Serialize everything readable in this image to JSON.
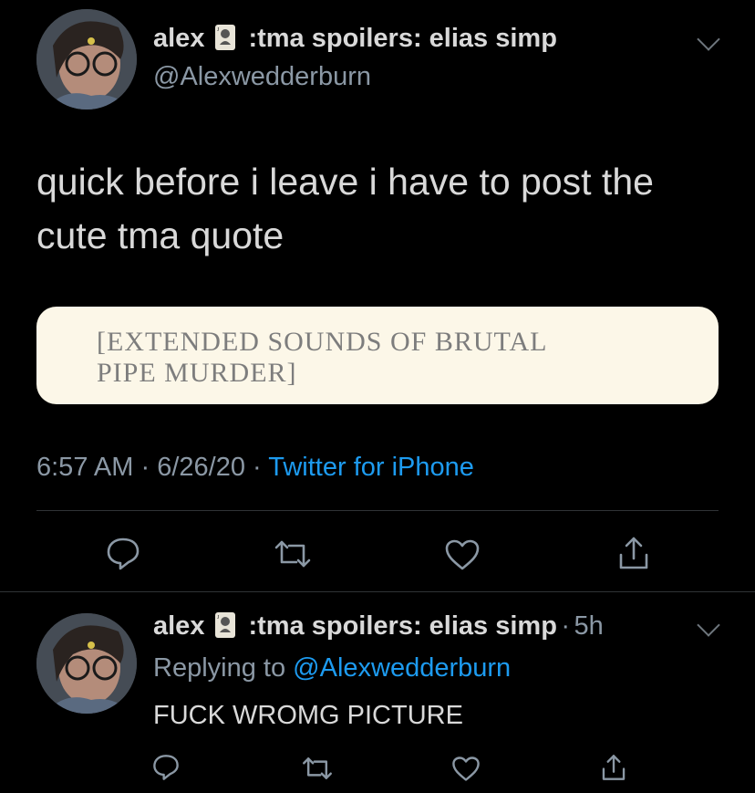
{
  "main_tweet": {
    "display_name": "alex",
    "name_suffix": ":tma spoilers: elias simp",
    "handle": "@Alexwedderburn",
    "text": "quick before i leave i have to post the cute tma quote",
    "image_quote_line1": "[EXTENDED SOUNDS OF BRUTAL",
    "image_quote_line2": "PIPE MURDER]",
    "time": "6:57 AM",
    "date": "6/26/20",
    "source": "Twitter for iPhone",
    "sep": "·"
  },
  "reply_tweet": {
    "display_name": "alex",
    "name_suffix": ":tma spoilers: elias simp",
    "age": "5h",
    "sep": "·",
    "replying_prefix": "Replying to",
    "replying_handle": "@Alexwedderburn",
    "text": "FUCK WROMG PICTURE"
  },
  "icons": [
    "avatar",
    "playing-card-joker-icon",
    "chevron-down-icon",
    "reply-icon",
    "retweet-icon",
    "like-icon",
    "share-icon"
  ],
  "colors": {
    "background": "#000000",
    "link": "#1d9bf0",
    "muted": "#8b98a5",
    "text": "#d9d9d9",
    "image_bg": "#fcf7e8"
  }
}
